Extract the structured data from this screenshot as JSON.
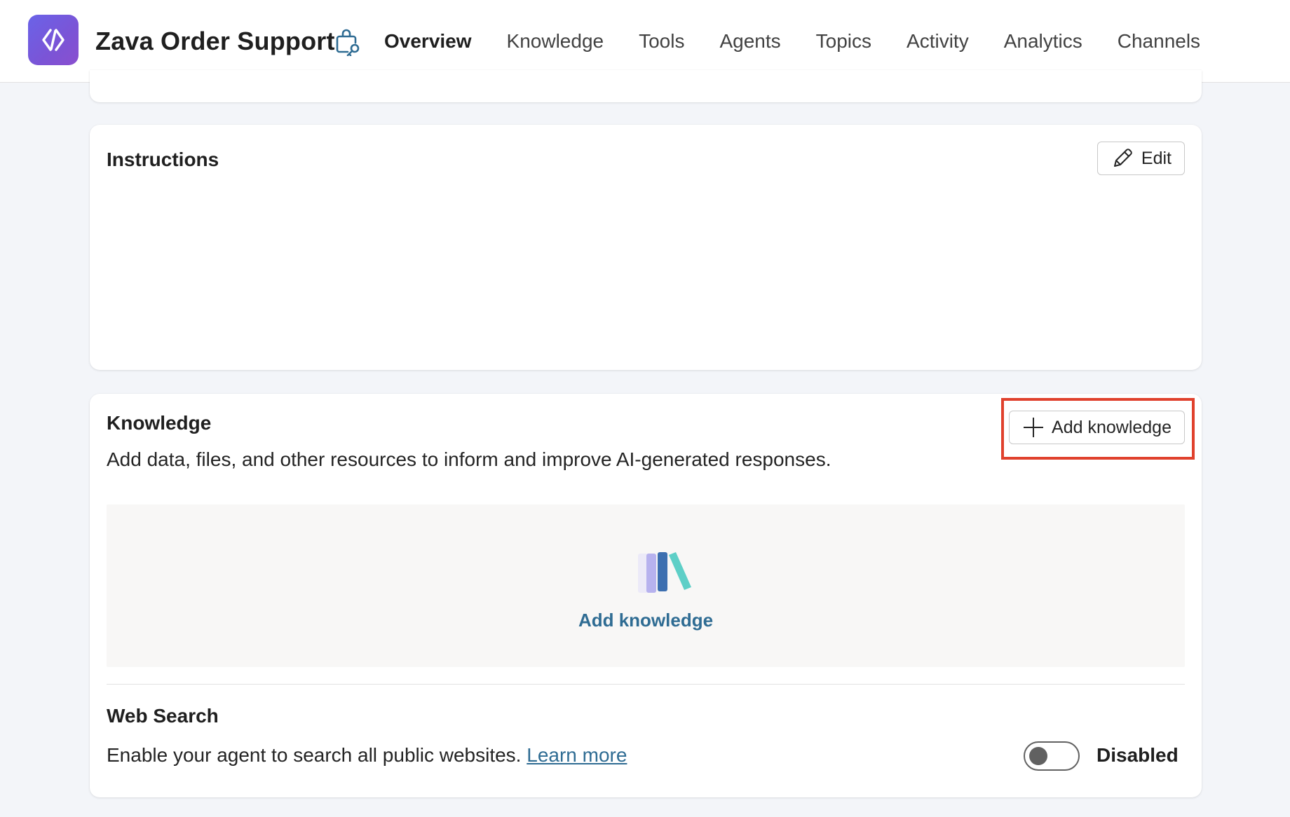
{
  "header": {
    "app_logo_icon": "code-brackets-icon",
    "agent_name": "Zava Order Support",
    "agent_badge_icon": "agent-key-icon",
    "tabs": [
      {
        "label": "Overview",
        "active": true
      },
      {
        "label": "Knowledge",
        "active": false
      },
      {
        "label": "Tools",
        "active": false
      },
      {
        "label": "Agents",
        "active": false
      },
      {
        "label": "Topics",
        "active": false
      },
      {
        "label": "Activity",
        "active": false
      },
      {
        "label": "Analytics",
        "active": false
      },
      {
        "label": "Channels",
        "active": false
      }
    ]
  },
  "instructions": {
    "title": "Instructions",
    "edit_label": "Edit",
    "edit_icon": "pencil-icon"
  },
  "knowledge": {
    "title": "Knowledge",
    "description": "Add data, files, and other resources to inform and improve AI-generated responses.",
    "add_button_label": "Add knowledge",
    "add_button_icon": "plus-icon",
    "empty_state_icon": "books-icon",
    "empty_state_link": "Add knowledge"
  },
  "web_search": {
    "title": "Web Search",
    "description": "Enable your agent to search all public websites.",
    "learn_more": "Learn more",
    "toggle_state": "Disabled",
    "enabled": false
  },
  "colors": {
    "accent": "#2f6c93",
    "highlight": "#e0412d",
    "logo_gradient_start": "#6a63e8",
    "logo_gradient_end": "#8a4fcf"
  }
}
